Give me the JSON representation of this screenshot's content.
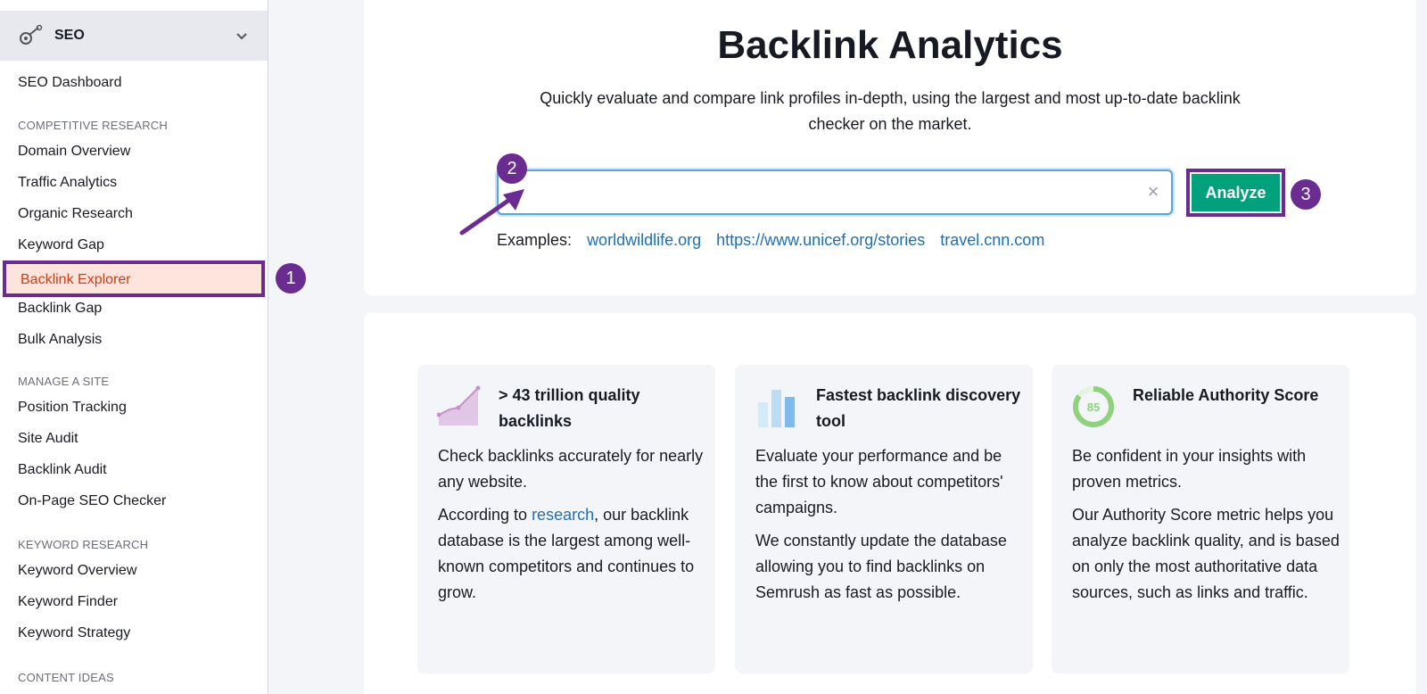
{
  "sidebar": {
    "section_title": "SEO",
    "dashboard": "SEO Dashboard",
    "groups": {
      "competitive": "COMPETITIVE RESEARCH",
      "manage": "MANAGE A SITE",
      "keyword": "KEYWORD RESEARCH",
      "content": "CONTENT IDEAS"
    },
    "competitive_items": [
      "Domain Overview",
      "Traffic Analytics",
      "Organic Research",
      "Keyword Gap"
    ],
    "active_item": "Backlink Explorer",
    "competitive_items_after": [
      "Backlink Gap",
      "Bulk Analysis"
    ],
    "manage_items": [
      "Position Tracking",
      "Site Audit",
      "Backlink Audit",
      "On-Page SEO Checker"
    ],
    "keyword_items": [
      "Keyword Overview",
      "Keyword Finder",
      "Keyword Strategy"
    ]
  },
  "steps": [
    "1",
    "2",
    "3"
  ],
  "hero": {
    "title": "Backlink Analytics",
    "subtitle": "Quickly evaluate and compare link profiles in-depth, using the largest and most up-to-date backlink checker on the market.",
    "search_value": "",
    "clear_glyph": "×",
    "analyze_label": "Analyze",
    "examples_label": "Examples:",
    "examples": [
      "worldwildlife.org",
      "https://www.unicef.org/stories",
      "travel.cnn.com"
    ]
  },
  "features": [
    {
      "icon": "growth-chart-icon",
      "title": "> 43 trillion quality backlinks",
      "p1": "Check backlinks accurately for nearly any website.",
      "p2_before": "According to ",
      "p2_link": "research",
      "p2_after": ", our backlink database is the largest among well-known competitors and continues to grow."
    },
    {
      "icon": "bar-chart-icon",
      "title": "Fastest backlink discovery tool",
      "p1": "Evaluate your performance and be the first to know about competitors' campaigns.",
      "p2": "We constantly update the database allowing you to find backlinks on Semrush as fast as possible."
    },
    {
      "icon": "authority-score-icon",
      "score": "85",
      "title": "Reliable Authority Score",
      "p1": "Be confident in your insights with proven metrics.",
      "p2": "Our Authority Score metric helps you analyze backlink quality, and is based on only the most authoritative data sources, such as links and traffic."
    }
  ],
  "colors": {
    "accent_purple": "#6a2c91",
    "analyze_green": "#00a17c",
    "link_blue": "#1f6fb5",
    "active_text": "#c8401a"
  }
}
